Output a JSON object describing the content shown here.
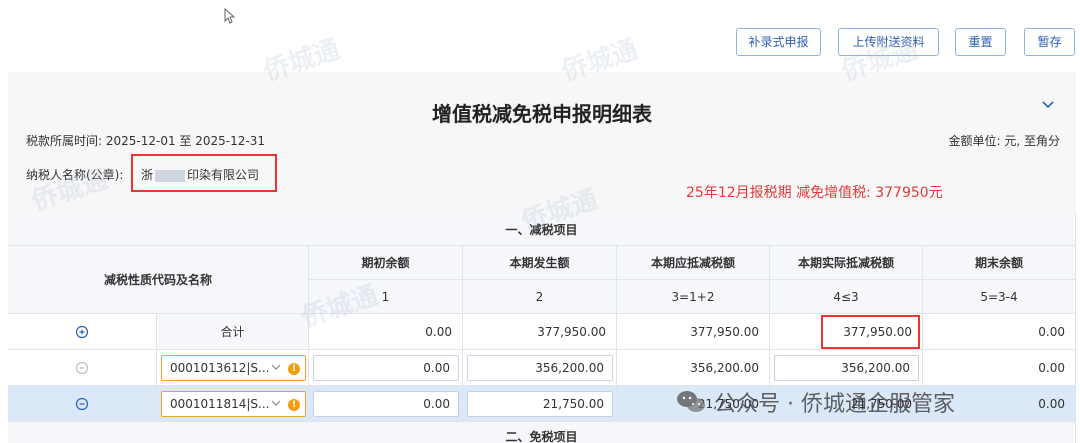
{
  "toolbar": {
    "buttons": [
      "补录式申报",
      "上传附送资料",
      "重置",
      "暂存"
    ]
  },
  "form": {
    "title": "增值税减免税申报明细表",
    "period_label": "税款所属时间:",
    "period_value": "2025-12-01 至 2025-12-31",
    "unit_label": "金额单位:",
    "unit_value": "元, 至角分",
    "taxpayer_label": "纳税人名称(公章):",
    "taxpayer_prefix": "浙",
    "taxpayer_suffix": "印染有限公司",
    "note": "25年12月报税期 减免增值税: 377950元"
  },
  "table": {
    "section_title": "一、减税项目",
    "col_code_name": "减税性质代码及名称",
    "columns": [
      {
        "label": "期初余额",
        "num": "1"
      },
      {
        "label": "本期发生额",
        "num": "2"
      },
      {
        "label": "本期应抵减税额",
        "num": "3=1+2"
      },
      {
        "label": "本期实际抵减税额",
        "num": "4≤3"
      },
      {
        "label": "期末余额",
        "num": "5=3-4"
      }
    ],
    "total_row": {
      "label": "合计",
      "values": [
        "0.00",
        "377,950.00",
        "377,950.00",
        "377,950.00",
        "0.00"
      ]
    },
    "rows": [
      {
        "code": "0001013612|S...",
        "values": [
          "0.00",
          "356,200.00",
          "356,200.00",
          "356,200.00",
          "0.00"
        ]
      },
      {
        "code": "0001011814|S...",
        "values": [
          "0.00",
          "21,750.00",
          "21,750.00",
          "21,750.00",
          "0.00"
        ]
      }
    ],
    "next_section": "二、免税项目"
  },
  "overlay": {
    "watermark_text": "侨城通",
    "wechat_text": "公众号 · 侨城通企服管家"
  },
  "colors": {
    "accent": "#2c5fb5",
    "highlight_red": "#e33333",
    "selected_row": "#dbe8f8"
  }
}
